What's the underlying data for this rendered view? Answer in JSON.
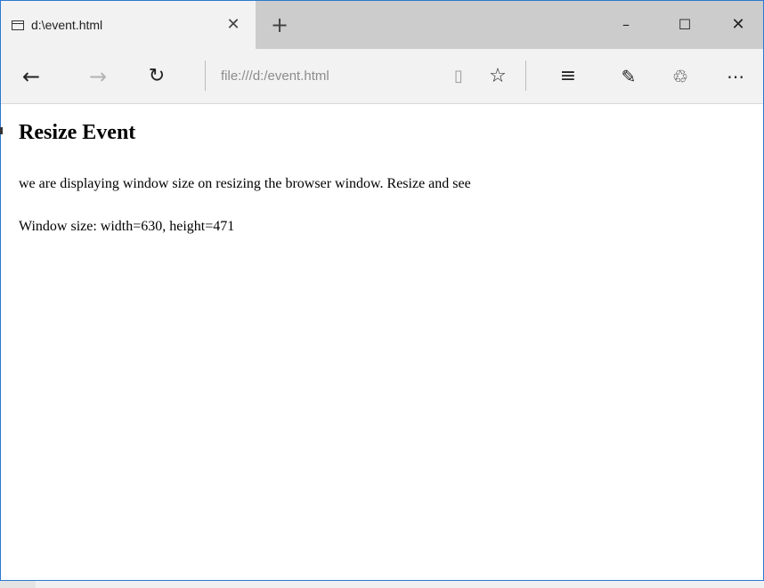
{
  "tab": {
    "title": "d:\\event.html",
    "close_glyph": "✕",
    "page_icon": "page-icon"
  },
  "new_tab_glyph": "+",
  "window_controls": {
    "minimize": "–",
    "maximize": "☐",
    "close": "✕"
  },
  "toolbar": {
    "back": "←",
    "forward": "→",
    "refresh": "↻",
    "address": "file:///d:/event.html",
    "reading_view": "▯",
    "favorite": "☆",
    "hub": "≡",
    "web_note": "✎",
    "share": "♲",
    "more": "⋯"
  },
  "page": {
    "title": "Resize Event",
    "description": "we are displaying window size on resizing the browser window. Resize and see",
    "size_line": "Window size: width=630, height=471"
  },
  "colors": {
    "frame_border": "#2b79d0",
    "title_bar": "#cccccc",
    "active_tab": "#f2f2f2"
  }
}
